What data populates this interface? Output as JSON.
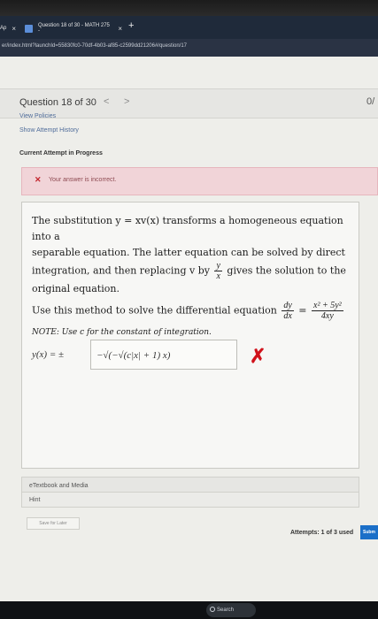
{
  "browser": {
    "tabs": [
      {
        "label": "Ap",
        "close": "×"
      },
      {
        "label": "Question 18 of 30 - MATH 275 -",
        "close": "×"
      }
    ],
    "new_tab": "+",
    "url": "er/index.html?launchId=55830fc0-70df-4b03-af85-c2599dd21206#/question/17"
  },
  "header": {
    "title": "Question 18 of 30",
    "prev": "<",
    "next": ">",
    "score": "0/"
  },
  "links": {
    "view_policies": "View Policies",
    "show_history": "Show Attempt History"
  },
  "attempt": {
    "label": "Current Attempt in Progress",
    "alert": "Your answer is incorrect."
  },
  "question": {
    "line1": "The substitution y = xv(x) transforms a homogeneous equation into a",
    "line2": "separable equation. The latter equation can be solved by direct",
    "line3_a": "integration, and then replacing v by",
    "frac1_num": "y",
    "frac1_den": "x",
    "line3_b": "gives the solution to the",
    "line4": "original equation.",
    "line5": "Use this method to solve the differential equation",
    "frac2_num": "dy",
    "frac2_den": "dx",
    "eq": "=",
    "frac3_num": "x² + 5y²",
    "frac3_den": "4xy",
    "note": "NOTE: Use c for the constant of integration."
  },
  "answer": {
    "lhs": "y(x) = ±",
    "value": "−√(−√(c|x| + 1) x)",
    "status": "✗"
  },
  "resources": {
    "etextbook": "eTextbook and Media",
    "hint": "Hint",
    "save_later": "Save for Later"
  },
  "footer": {
    "attempts": "Attempts: 1 of 3 used",
    "submit": "Subm"
  },
  "taskbar": {
    "search": "Search"
  }
}
